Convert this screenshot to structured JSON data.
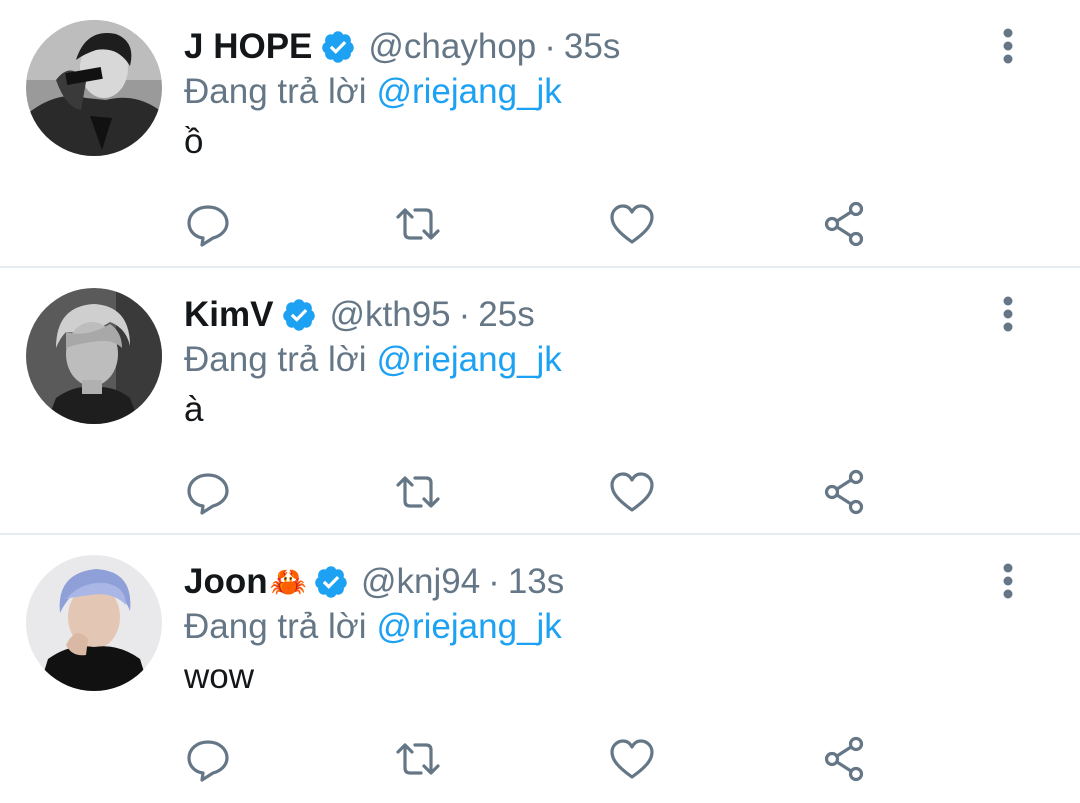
{
  "tweets": [
    {
      "name": "J HOPE",
      "emoji": "",
      "handle": "@chayhop",
      "separator": "·",
      "time": "35s",
      "reply_prefix": "Đang trả lời",
      "reply_to": "@riejang_jk",
      "text": "ồ"
    },
    {
      "name": "KimV",
      "emoji": "",
      "handle": "@kth95",
      "separator": "·",
      "time": "25s",
      "reply_prefix": "Đang trả lời",
      "reply_to": "@riejang_jk",
      "text": "à"
    },
    {
      "name": "Joon",
      "emoji": "🦀",
      "handle": "@knj94",
      "separator": "·",
      "time": "13s",
      "reply_prefix": "Đang trả lời",
      "reply_to": "@riejang_jk",
      "text": "wow"
    }
  ],
  "icons": {
    "verified": "verified-badge-icon",
    "more": "more-vertical-icon",
    "reply": "reply-icon",
    "retweet": "retweet-icon",
    "like": "heart-icon",
    "share": "share-icon"
  },
  "colors": {
    "accent": "#1da1f2",
    "muted": "#657786",
    "text": "#14171a",
    "divider": "#e6ecf0"
  }
}
